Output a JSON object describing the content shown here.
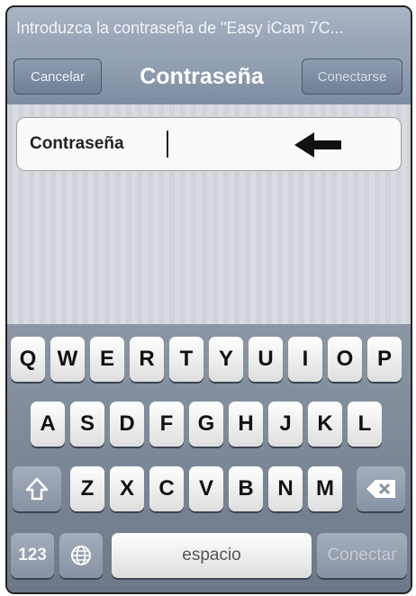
{
  "prompt": "Introduzca la contraseña de \"Easy iCam 7C...",
  "nav": {
    "cancel_label": "Cancelar",
    "title": "Contraseña",
    "connect_label": "Conectarse"
  },
  "password_field": {
    "label": "Contraseña",
    "value": ""
  },
  "keyboard": {
    "row1": [
      "Q",
      "W",
      "E",
      "R",
      "T",
      "Y",
      "U",
      "I",
      "O",
      "P"
    ],
    "row2": [
      "A",
      "S",
      "D",
      "F",
      "G",
      "H",
      "J",
      "K",
      "L"
    ],
    "row3": [
      "Z",
      "X",
      "C",
      "V",
      "B",
      "N",
      "M"
    ],
    "numbers_label": "123",
    "space_label": "espacio",
    "go_label": "Conectar",
    "icons": {
      "shift": "shift-arrow-icon",
      "globe": "globe-icon",
      "delete": "backspace-icon"
    }
  }
}
